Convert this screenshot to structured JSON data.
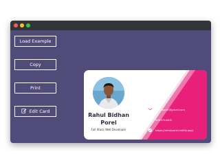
{
  "window": {
    "colors": {
      "background": "#514b7a",
      "titlebar": "#33333a",
      "close": "#f25f58",
      "minimize": "#f9bd2e",
      "maximize": "#3dc43f"
    }
  },
  "sidebar": {
    "buttons": [
      {
        "label": "Load Example"
      },
      {
        "label": "Copy"
      },
      {
        "label": "Print"
      },
      {
        "label": "Edit Card",
        "icon": "edit-icon"
      }
    ]
  },
  "card": {
    "name": "Rahul Bidhan Porel",
    "role": "Full Stack Web Developer",
    "contacts": [
      {
        "icon": "email-icon",
        "text": "rahulporel@gmail.com"
      },
      {
        "icon": "phone-icon",
        "text": "9083744401"
      },
      {
        "icon": "link-icon",
        "text": "https://rahulporel.netlify.app/"
      }
    ],
    "colors": {
      "accent": "#e8217a",
      "accent_light": "#f7dfe8",
      "background": "#ffffff"
    }
  }
}
